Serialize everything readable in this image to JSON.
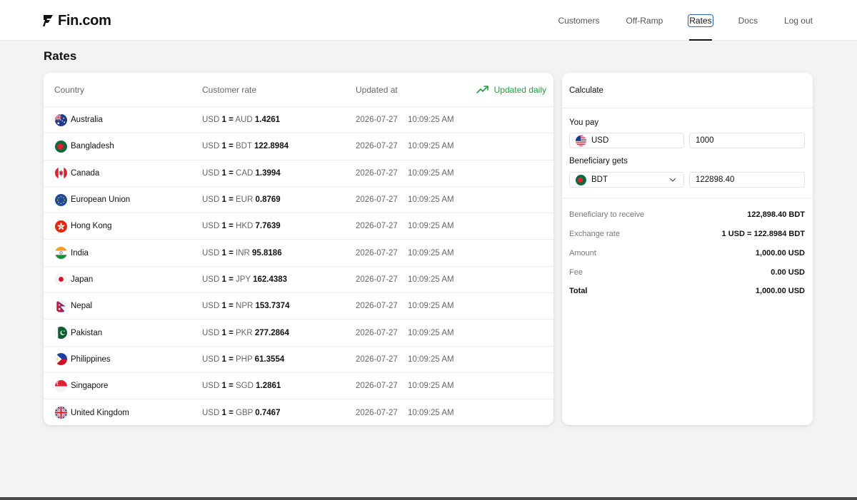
{
  "brand": {
    "name": "Fin.com"
  },
  "nav": [
    {
      "label": "Customers",
      "active": false
    },
    {
      "label": "Off-Ramp",
      "active": false
    },
    {
      "label": "Rates",
      "active": true
    },
    {
      "label": "Docs",
      "active": false
    },
    {
      "label": "Log out",
      "active": false
    }
  ],
  "page": {
    "title": "Rates"
  },
  "table": {
    "headers": {
      "country": "Country",
      "rate": "Customer rate",
      "updated": "Updated at"
    },
    "badge": "Updated daily",
    "rows": [
      {
        "flag": "australia-flag-icon",
        "country": "Australia",
        "base": "USD",
        "one": "1",
        "eq": "=",
        "quote": "AUD",
        "value": "1.4261",
        "date": "2026-07-27",
        "time": "10:09:25 AM"
      },
      {
        "flag": "bangladesh-flag-icon",
        "country": "Bangladesh",
        "base": "USD",
        "one": "1",
        "eq": "=",
        "quote": "BDT",
        "value": "122.8984",
        "date": "2026-07-27",
        "time": "10:09:25 AM"
      },
      {
        "flag": "canada-flag-icon",
        "country": "Canada",
        "base": "USD",
        "one": "1",
        "eq": "=",
        "quote": "CAD",
        "value": "1.3994",
        "date": "2026-07-27",
        "time": "10:09:25 AM"
      },
      {
        "flag": "eu-flag-icon",
        "country": "European Union",
        "base": "USD",
        "one": "1",
        "eq": "=",
        "quote": "EUR",
        "value": "0.8769",
        "date": "2026-07-27",
        "time": "10:09:25 AM"
      },
      {
        "flag": "hong-kong-flag-icon",
        "country": "Hong Kong",
        "base": "USD",
        "one": "1",
        "eq": "=",
        "quote": "HKD",
        "value": "7.7639",
        "date": "2026-07-27",
        "time": "10:09:25 AM"
      },
      {
        "flag": "india-flag-icon",
        "country": "India",
        "base": "USD",
        "one": "1",
        "eq": "=",
        "quote": "INR",
        "value": "95.8186",
        "date": "2026-07-27",
        "time": "10:09:25 AM"
      },
      {
        "flag": "japan-flag-icon",
        "country": "Japan",
        "base": "USD",
        "one": "1",
        "eq": "=",
        "quote": "JPY",
        "value": "162.4383",
        "date": "2026-07-27",
        "time": "10:09:25 AM"
      },
      {
        "flag": "nepal-flag-icon",
        "country": "Nepal",
        "base": "USD",
        "one": "1",
        "eq": "=",
        "quote": "NPR",
        "value": "153.7374",
        "date": "2026-07-27",
        "time": "10:09:25 AM"
      },
      {
        "flag": "pakistan-flag-icon",
        "country": "Pakistan",
        "base": "USD",
        "one": "1",
        "eq": "=",
        "quote": "PKR",
        "value": "277.2864",
        "date": "2026-07-27",
        "time": "10:09:25 AM"
      },
      {
        "flag": "philippines-flag-icon",
        "country": "Philippines",
        "base": "USD",
        "one": "1",
        "eq": "=",
        "quote": "PHP",
        "value": "61.3554",
        "date": "2026-07-27",
        "time": "10:09:25 AM"
      },
      {
        "flag": "singapore-flag-icon",
        "country": "Singapore",
        "base": "USD",
        "one": "1",
        "eq": "=",
        "quote": "SGD",
        "value": "1.2861",
        "date": "2026-07-27",
        "time": "10:09:25 AM"
      },
      {
        "flag": "uk-flag-icon",
        "country": "United Kingdom",
        "base": "USD",
        "one": "1",
        "eq": "=",
        "quote": "GBP",
        "value": "0.7467",
        "date": "2026-07-27",
        "time": "10:09:25 AM"
      }
    ]
  },
  "calculator": {
    "title": "Calculate",
    "you_pay_label": "You pay",
    "pay_currency": "USD",
    "pay_amount": "1000",
    "beneficiary_label": "Beneficiary gets",
    "receive_currency": "BDT",
    "receive_amount": "122898.40",
    "summary": [
      {
        "label": "Beneficiary to receive",
        "value": "122,898.40 BDT"
      },
      {
        "label": "Exchange rate",
        "value": "1 USD = 122.8984 BDT"
      },
      {
        "label": "Amount",
        "value": "1,000.00 USD"
      },
      {
        "label": "Fee",
        "value": "0.00 USD"
      },
      {
        "label": "Total",
        "value": "1,000.00 USD"
      }
    ]
  },
  "colors": {
    "accent_green": "#1f9d3c",
    "focus_blue": "#2a62c9",
    "text": "#111111",
    "muted": "#666666"
  }
}
